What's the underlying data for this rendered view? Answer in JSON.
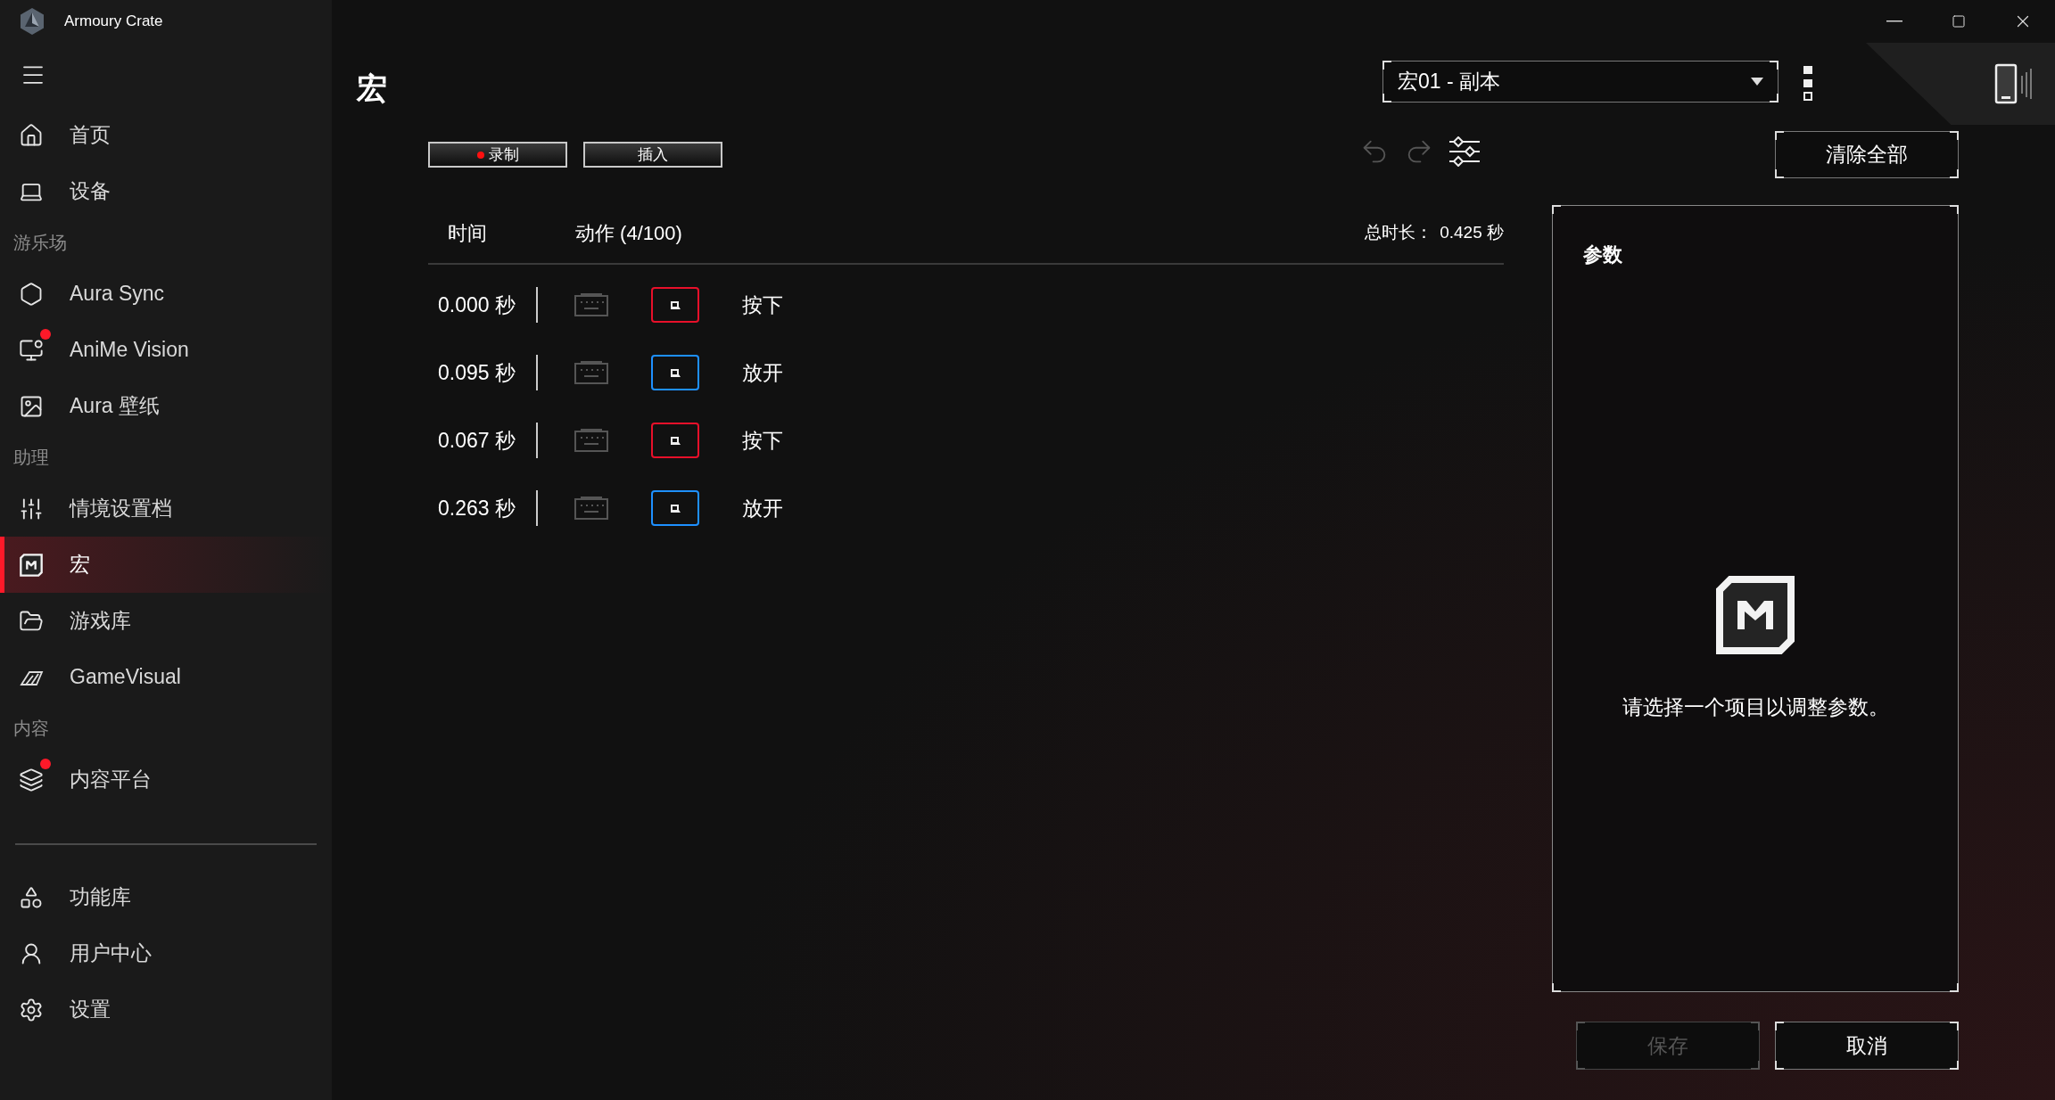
{
  "window": {
    "title": "Armoury Crate"
  },
  "sidebar": {
    "items": [
      {
        "kind": "item",
        "label": "首页",
        "selected": false,
        "badge": false
      },
      {
        "kind": "item",
        "label": "设备",
        "selected": false,
        "badge": false
      },
      {
        "kind": "section",
        "label": "游乐场"
      },
      {
        "kind": "item",
        "label": "Aura Sync",
        "selected": false,
        "badge": false
      },
      {
        "kind": "item",
        "label": "AniMe Vision",
        "selected": false,
        "badge": true
      },
      {
        "kind": "item",
        "label": "Aura 壁纸",
        "selected": false,
        "badge": false
      },
      {
        "kind": "section",
        "label": "助理"
      },
      {
        "kind": "item",
        "label": "情境设置档",
        "selected": false,
        "badge": false
      },
      {
        "kind": "item",
        "label": "宏",
        "selected": true,
        "badge": false
      },
      {
        "kind": "item",
        "label": "游戏库",
        "selected": false,
        "badge": false
      },
      {
        "kind": "item",
        "label": "GameVisual",
        "selected": false,
        "badge": false
      },
      {
        "kind": "section",
        "label": "内容"
      },
      {
        "kind": "item",
        "label": "内容平台",
        "selected": false,
        "badge": true
      }
    ],
    "bottom_items": [
      {
        "label": "功能库",
        "selected": false
      },
      {
        "label": "用户中心",
        "selected": false
      },
      {
        "label": "设置",
        "selected": false
      }
    ]
  },
  "page": {
    "title": "宏",
    "macro_select": {
      "value": "宏01 - 副本"
    }
  },
  "toolbar": {
    "record": "录制",
    "insert": "插入",
    "undo_disabled": true,
    "redo_disabled": true,
    "clear_all": "清除全部"
  },
  "table": {
    "columns": [
      "时间",
      "动作 (4/100)"
    ],
    "total_label": "总时长：",
    "total_value": "0.425 秒",
    "rows": [
      {
        "time": "0.000 秒",
        "kind": "press",
        "action": "按下"
      },
      {
        "time": "0.095 秒",
        "kind": "release",
        "action": "放开"
      },
      {
        "time": "0.067 秒",
        "kind": "press",
        "action": "按下"
      },
      {
        "time": "0.263 秒",
        "kind": "release",
        "action": "放开"
      }
    ]
  },
  "params": {
    "title": "参数",
    "message": "请选择一个项目以调整参数。"
  },
  "footer": [
    {
      "label": "保存",
      "disabled": true
    },
    {
      "label": "取消",
      "disabled": false
    }
  ]
}
